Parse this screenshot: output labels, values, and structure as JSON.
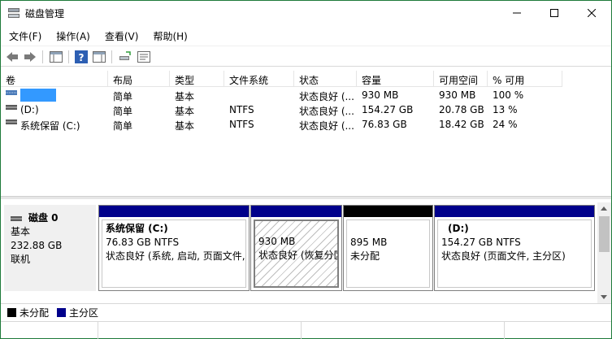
{
  "window": {
    "title": "磁盘管理"
  },
  "menu": [
    "文件(F)",
    "操作(A)",
    "查看(V)",
    "帮助(H)"
  ],
  "volume_table": {
    "columns": [
      "卷",
      "布局",
      "类型",
      "文件系统",
      "状态",
      "容量",
      "可用空间",
      "% 可用"
    ],
    "rows": [
      {
        "name": "",
        "layout": "简单",
        "type": "基本",
        "fs": "",
        "status": "状态良好 (...",
        "capacity": "930 MB",
        "free": "930 MB",
        "pct": "100 %"
      },
      {
        "name": "(D:)",
        "layout": "简单",
        "type": "基本",
        "fs": "NTFS",
        "status": "状态良好 (...",
        "capacity": "154.27 GB",
        "free": "20.78 GB",
        "pct": "13 %"
      },
      {
        "name": "系统保留 (C:)",
        "layout": "简单",
        "type": "基本",
        "fs": "NTFS",
        "status": "状态良好 (...",
        "capacity": "76.83 GB",
        "free": "18.42 GB",
        "pct": "24 %"
      }
    ]
  },
  "disk": {
    "name": "磁盘 0",
    "type": "基本",
    "size": "232.88 GB",
    "state": "联机",
    "partitions": [
      {
        "title": "系统保留  (C:)",
        "line2": "76.83 GB NTFS",
        "line3": "状态良好 (系统, 启动, 页面文件,",
        "kind": "primary"
      },
      {
        "title": "",
        "line2": "930 MB",
        "line3": "状态良好 (恢复分区)",
        "kind": "primary"
      },
      {
        "title": "",
        "line2": "895 MB",
        "line3": "未分配",
        "kind": "unallocated"
      },
      {
        "title": "(D:)",
        "line2": "154.27 GB NTFS",
        "line3": "状态良好 (页面文件, 主分区)",
        "kind": "primary"
      }
    ]
  },
  "legend": [
    {
      "label": "未分配",
      "color": "#000000"
    },
    {
      "label": "主分区",
      "color": "#00008b"
    }
  ],
  "colors": {
    "primary": "#00008b",
    "unallocated": "#000000",
    "selection": "#3399ff"
  }
}
